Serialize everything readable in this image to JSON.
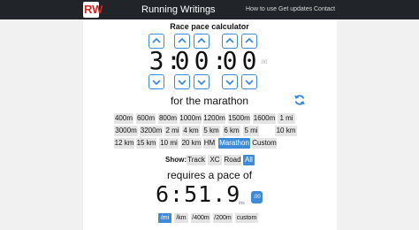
{
  "nav": {
    "logo_text": "RW",
    "brand": "Running Writings",
    "links": [
      "How to use",
      "Get updates",
      "Contact"
    ]
  },
  "calculator": {
    "title": "Race pace calculator",
    "time_digits": [
      "3",
      "0",
      "0",
      "0",
      "0"
    ],
    "separator": ":",
    "fraction": ".00",
    "race_label": "for the marathon"
  },
  "distances": {
    "row1": [
      "400m",
      "600m",
      "800m",
      "1000m",
      "1200m",
      "1500m",
      "1600m",
      "1 mi"
    ],
    "row2": [
      "3000m",
      "3200m",
      "2 mi",
      "4 km",
      "5 km",
      "6 km",
      "5 mi",
      "10 km"
    ],
    "row3": [
      "12 km",
      "15 km",
      "10 mi",
      "20 km",
      "HM",
      "Marathon",
      "Custom"
    ],
    "selected": "Marathon"
  },
  "show": {
    "label": "Show:",
    "options": [
      "Track",
      "XC",
      "Road",
      "All"
    ],
    "selected": "All"
  },
  "result": {
    "requires_label": "requires a pace of",
    "pace": "6:51.9",
    "unit": "/mi",
    "fraction_button": ".00"
  },
  "units": {
    "options": [
      "/mi",
      "/km",
      "/400m",
      "/200m",
      "custom"
    ],
    "selected": "/mi"
  },
  "colors": {
    "accent": "#3d8ad9",
    "navbar": "#212529",
    "logo": "#d9231d",
    "pill": "#e4e4e4"
  }
}
